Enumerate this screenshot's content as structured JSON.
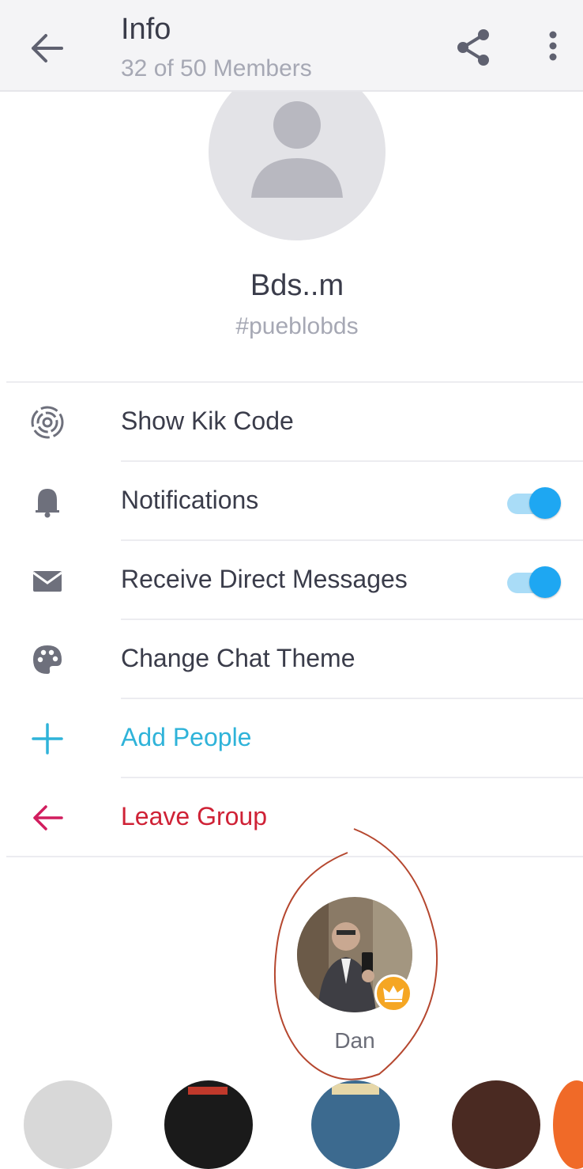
{
  "header": {
    "title": "Info",
    "subtitle": "32 of 50 Members"
  },
  "group": {
    "name": "Bds..m",
    "hashtag": "#pueblobds"
  },
  "menu": {
    "show_kik_code": "Show Kik Code",
    "notifications": "Notifications",
    "receive_direct_messages": "Receive Direct Messages",
    "change_chat_theme": "Change Chat Theme",
    "add_people": "Add People",
    "leave_group": "Leave Group"
  },
  "toggles": {
    "notifications_on": true,
    "direct_messages_on": true
  },
  "members": [
    {
      "name": "Dan",
      "badge": "crown-icon"
    }
  ],
  "icons": {
    "back": "arrow-left-icon",
    "share": "share-icon",
    "more": "more-vertical-icon",
    "kik_code": "kik-code-icon",
    "notifications": "bell-icon",
    "direct_messages": "envelope-icon",
    "theme": "palette-icon",
    "add": "plus-icon",
    "leave": "arrow-left-icon"
  },
  "colors": {
    "accent_blue": "#2fb3d9",
    "toggle_blue": "#1ea7f2",
    "leave_red": "#cf2236",
    "leave_icon": "#d11d5e",
    "crown_orange": "#f5a623"
  }
}
